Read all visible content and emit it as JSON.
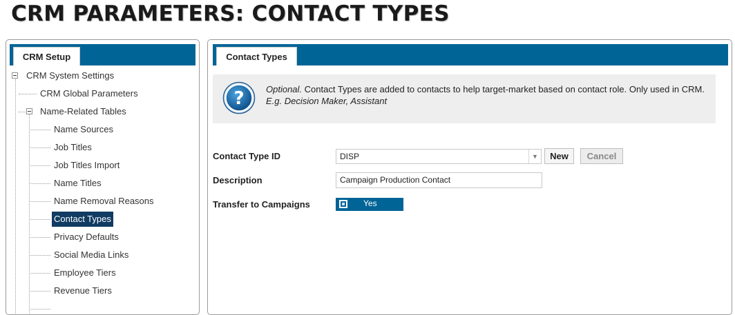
{
  "page": {
    "title": "CRM PARAMETERS: CONTACT TYPES"
  },
  "left_panel": {
    "tab_label": "CRM Setup",
    "tree": {
      "root": "CRM System Settings",
      "items": [
        "CRM Global Parameters",
        "Name-Related Tables",
        "Name Sources",
        "Job Titles",
        "Job Titles Import",
        "Name Titles",
        "Name Removal Reasons",
        "Contact Types",
        "Privacy Defaults",
        "Social Media Links",
        "Employee Tiers",
        "Revenue Tiers"
      ],
      "selected": "Contact Types"
    }
  },
  "right_panel": {
    "tab_label": "Contact Types",
    "info": {
      "icon": "question-help-icon",
      "optional_word": "Optional.",
      "description": " Contact Types are added to contacts to help target-market based on contact role. Only used in CRM.",
      "example": "E.g. Decision Maker, Assistant"
    },
    "form": {
      "contact_type_id_label": "Contact Type ID",
      "contact_type_id_value": "DISP",
      "new_button": "New",
      "cancel_button": "Cancel",
      "description_label": "Description",
      "description_value": "Campaign Production Contact",
      "transfer_label": "Transfer to Campaigns",
      "transfer_value": "Yes"
    }
  },
  "colors": {
    "header_blue": "#006496",
    "selected_bg": "#103b63",
    "info_bg": "#eeeeee"
  }
}
